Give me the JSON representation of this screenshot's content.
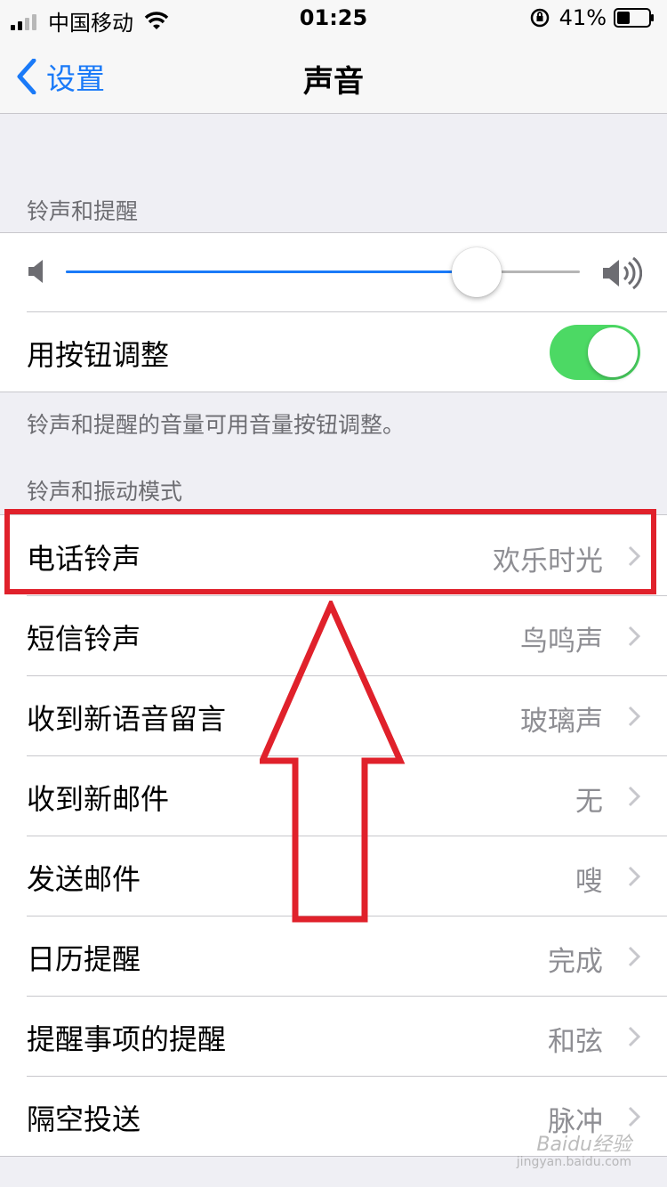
{
  "status_bar": {
    "carrier": "中国移动",
    "time": "01:25",
    "battery_pct": "41%",
    "battery_level": 0.41
  },
  "nav": {
    "back_label": "设置",
    "title": "声音"
  },
  "ringer": {
    "header": "铃声和提醒",
    "volume_level": 0.8,
    "toggle_label": "用按钮调整",
    "toggle_on": true,
    "footer": "铃声和提醒的音量可用音量按钮调整。"
  },
  "sounds": {
    "header": "铃声和振动模式",
    "items": [
      {
        "label": "电话铃声",
        "value": "欢乐时光"
      },
      {
        "label": "短信铃声",
        "value": "鸟鸣声"
      },
      {
        "label": "收到新语音留言",
        "value": "玻璃声"
      },
      {
        "label": "收到新邮件",
        "value": "无"
      },
      {
        "label": "发送邮件",
        "value": "嗖"
      },
      {
        "label": "日历提醒",
        "value": "完成"
      },
      {
        "label": "提醒事项的提醒",
        "value": "和弦"
      },
      {
        "label": "隔空投送",
        "value": "脉冲"
      }
    ]
  },
  "watermark": {
    "brand": "Baidu经验",
    "url": "jingyan.baidu.com"
  },
  "colors": {
    "accent": "#1a7af8",
    "toggle_on": "#4cd964",
    "highlight": "#e0212b"
  }
}
